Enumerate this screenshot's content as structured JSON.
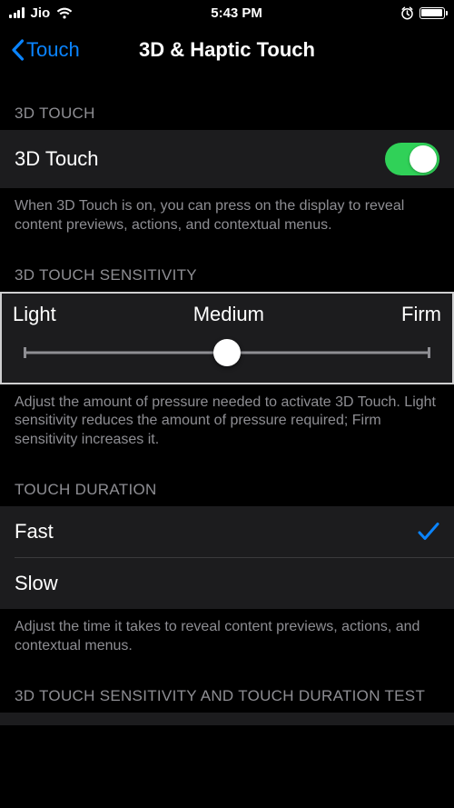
{
  "status": {
    "carrier": "Jio",
    "time": "5:43 PM"
  },
  "nav": {
    "back": "Touch",
    "title": "3D & Haptic Touch"
  },
  "sections": {
    "touch3d": {
      "header": "3D TOUCH",
      "rowLabel": "3D Touch",
      "footer": "When 3D Touch is on, you can press on the display to reveal content previews, actions, and contextual menus."
    },
    "sensitivity": {
      "header": "3D TOUCH SENSITIVITY",
      "labels": {
        "left": "Light",
        "mid": "Medium",
        "right": "Firm"
      },
      "footer": "Adjust the amount of pressure needed to activate 3D Touch. Light sensitivity reduces the amount of pressure required; Firm sensitivity increases it."
    },
    "duration": {
      "header": "TOUCH DURATION",
      "fast": "Fast",
      "slow": "Slow",
      "footer": "Adjust the time it takes to reveal content previews, actions, and contextual menus."
    },
    "test": {
      "header": "3D TOUCH SENSITIVITY AND TOUCH DURATION TEST"
    }
  }
}
